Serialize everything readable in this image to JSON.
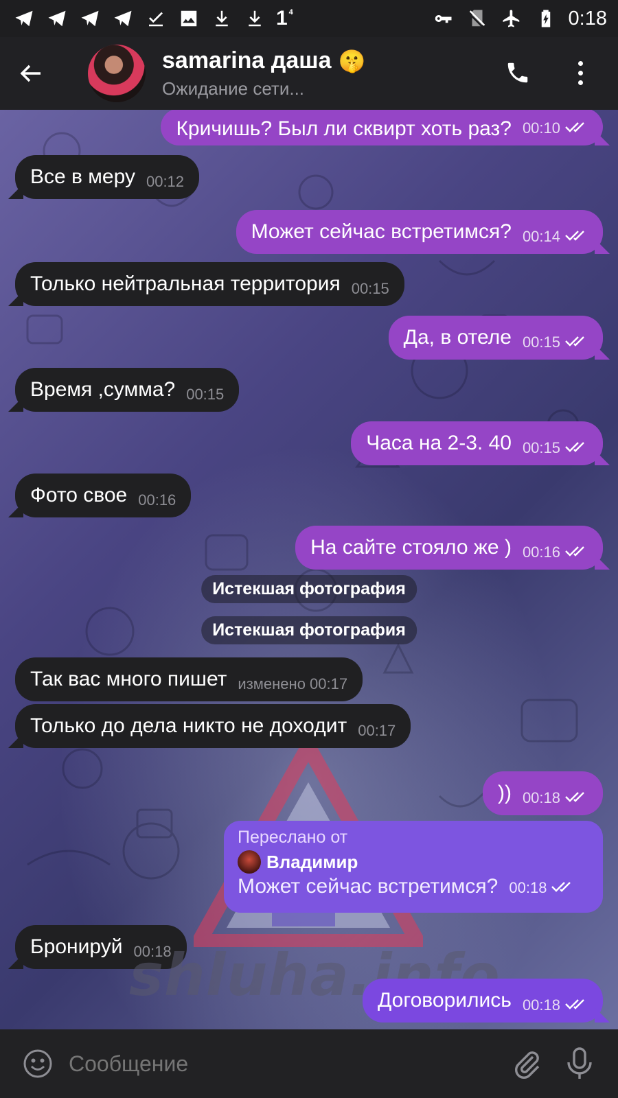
{
  "status_bar": {
    "time": "0:18",
    "left_icons": [
      "telegram-icon",
      "telegram-icon",
      "telegram-icon",
      "telegram-icon",
      "download-done-icon",
      "image-icon",
      "download-icon",
      "download-icon"
    ],
    "one_label": "1",
    "one_sup": "4",
    "right_icons": [
      "key-icon",
      "no-sim-icon",
      "airplane-icon",
      "battery-charging-icon"
    ]
  },
  "header": {
    "name": "samarina даша",
    "name_emoji": "🤫",
    "status": "Ожидание сети..."
  },
  "messages": [
    {
      "dir": "out",
      "text": "Кричишь? Был ли сквирт хоть раз?",
      "time": "00:10"
    },
    {
      "dir": "in",
      "text": "Все в меру",
      "time": "00:12"
    },
    {
      "dir": "out",
      "text": "Может сейчас встретимся?",
      "time": "00:14"
    },
    {
      "dir": "in",
      "text": "Только нейтральная территория",
      "time": "00:15"
    },
    {
      "dir": "out",
      "text": "Да, в отеле",
      "time": "00:15"
    },
    {
      "dir": "in",
      "text": "Время ,сумма?",
      "time": "00:15"
    },
    {
      "dir": "out",
      "text": "Часа на 2-3. 40",
      "time": "00:15"
    },
    {
      "dir": "in",
      "text": "Фото свое",
      "time": "00:16"
    },
    {
      "dir": "out",
      "text": "На сайте стояло же )",
      "time": "00:16"
    },
    {
      "dir": "in",
      "text": "Так вас много пишет",
      "time": "изменено 00:17"
    },
    {
      "dir": "in",
      "text": "Только до дела никто не доходит",
      "time": "00:17"
    },
    {
      "dir": "out",
      "text": "))",
      "time": "00:18"
    },
    {
      "dir": "in",
      "text": "Бронируй",
      "time": "00:18"
    },
    {
      "dir": "out",
      "text": "Договорились",
      "time": "00:18"
    }
  ],
  "service_messages": [
    "Истекшая фотография",
    "Истекшая фотография"
  ],
  "forwarded": {
    "label": "Переслано от",
    "from": "Владимир",
    "text": "Может сейчас встретимся?",
    "time": "00:18"
  },
  "watermark": "shluha.info",
  "input": {
    "placeholder": "Сообщение"
  },
  "colors": {
    "outgoing_bubble": "#9545c6",
    "incoming_bubble": "#202022",
    "forward_bubble": "#7d55e0",
    "header_bg": "#212124"
  }
}
